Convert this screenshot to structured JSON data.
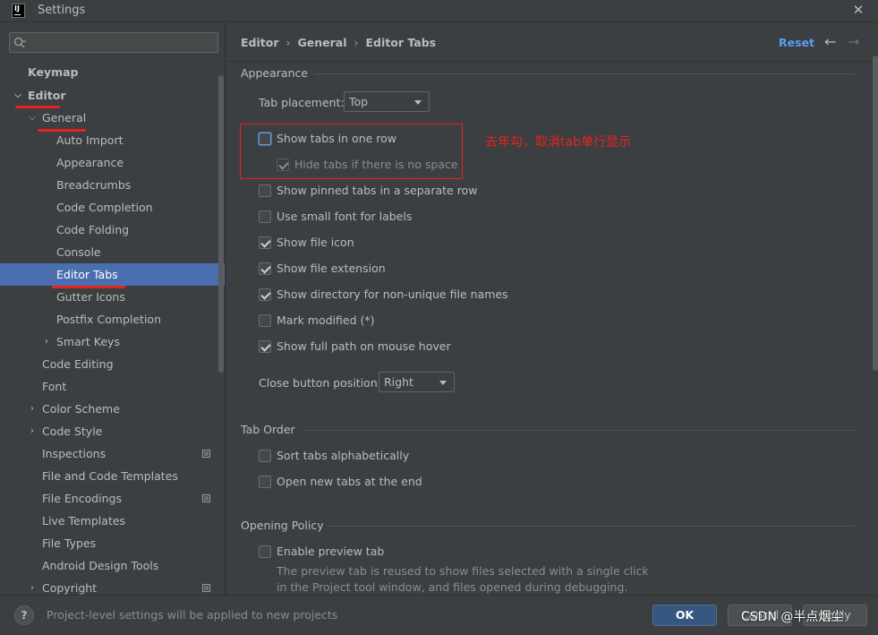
{
  "window": {
    "title": "Settings",
    "app_icon_text": "IJ"
  },
  "search": {
    "placeholder": "",
    "value": ""
  },
  "sidebar": {
    "items": [
      {
        "label": "Keymap"
      },
      {
        "label": "Editor"
      },
      {
        "label": "General"
      },
      {
        "label": "Auto Import"
      },
      {
        "label": "Appearance"
      },
      {
        "label": "Breadcrumbs"
      },
      {
        "label": "Code Completion"
      },
      {
        "label": "Code Folding"
      },
      {
        "label": "Console"
      },
      {
        "label": "Editor Tabs"
      },
      {
        "label": "Gutter Icons"
      },
      {
        "label": "Postfix Completion"
      },
      {
        "label": "Smart Keys"
      },
      {
        "label": "Code Editing"
      },
      {
        "label": "Font"
      },
      {
        "label": "Color Scheme"
      },
      {
        "label": "Code Style"
      },
      {
        "label": "Inspections"
      },
      {
        "label": "File and Code Templates"
      },
      {
        "label": "File Encodings"
      },
      {
        "label": "Live Templates"
      },
      {
        "label": "File Types"
      },
      {
        "label": "Android Design Tools"
      },
      {
        "label": "Copyright"
      }
    ],
    "selected": "Editor Tabs"
  },
  "breadcrumb": {
    "items": [
      "Editor",
      "General",
      "Editor Tabs"
    ]
  },
  "header": {
    "reset_label": "Reset",
    "back_icon": "←",
    "forward_icon": "→"
  },
  "appearance": {
    "title": "Appearance",
    "tab_placement_label": "Tab placement:",
    "tab_placement_value": "Top",
    "options": [
      {
        "label": "Show tabs in one row",
        "checked": false
      },
      {
        "label": "Hide tabs if there is no space",
        "checked": true,
        "disabled": true
      },
      {
        "label": "Show pinned tabs in a separate row",
        "checked": false
      },
      {
        "label": "Use small font for labels",
        "checked": false
      },
      {
        "label": "Show file icon",
        "checked": true
      },
      {
        "label": "Show file extension",
        "checked": true
      },
      {
        "label": "Show directory for non-unique file names",
        "checked": true
      },
      {
        "label": "Mark modified (*)",
        "checked": false
      },
      {
        "label": "Show full path on mouse hover",
        "checked": true
      }
    ],
    "close_button_label": "Close button position:",
    "close_button_value": "Right"
  },
  "annotation": {
    "text": "去年勾，取消tab单行显示",
    "color": "#e8231c"
  },
  "tab_order": {
    "title": "Tab Order",
    "options": [
      {
        "label": "Sort tabs alphabetically",
        "checked": false
      },
      {
        "label": "Open new tabs at the end",
        "checked": false
      }
    ]
  },
  "opening_policy": {
    "title": "Opening Policy",
    "options": [
      {
        "label": "Enable preview tab",
        "checked": false
      }
    ],
    "description_line1": "The preview tab is reused to show files selected with a single click",
    "description_line2": "in the Project tool window, and files opened during debugging."
  },
  "footer": {
    "help_label": "?",
    "note": "Project-level settings will be applied to new projects",
    "ok_label": "OK",
    "cancel_label": "Cancel",
    "apply_label": "Apply",
    "watermark": "CSDN @半点烟尘"
  },
  "colors": {
    "accent": "#4b6eaf",
    "link": "#589df6",
    "annotation": "#e8231c",
    "ok_button": "#365880"
  }
}
